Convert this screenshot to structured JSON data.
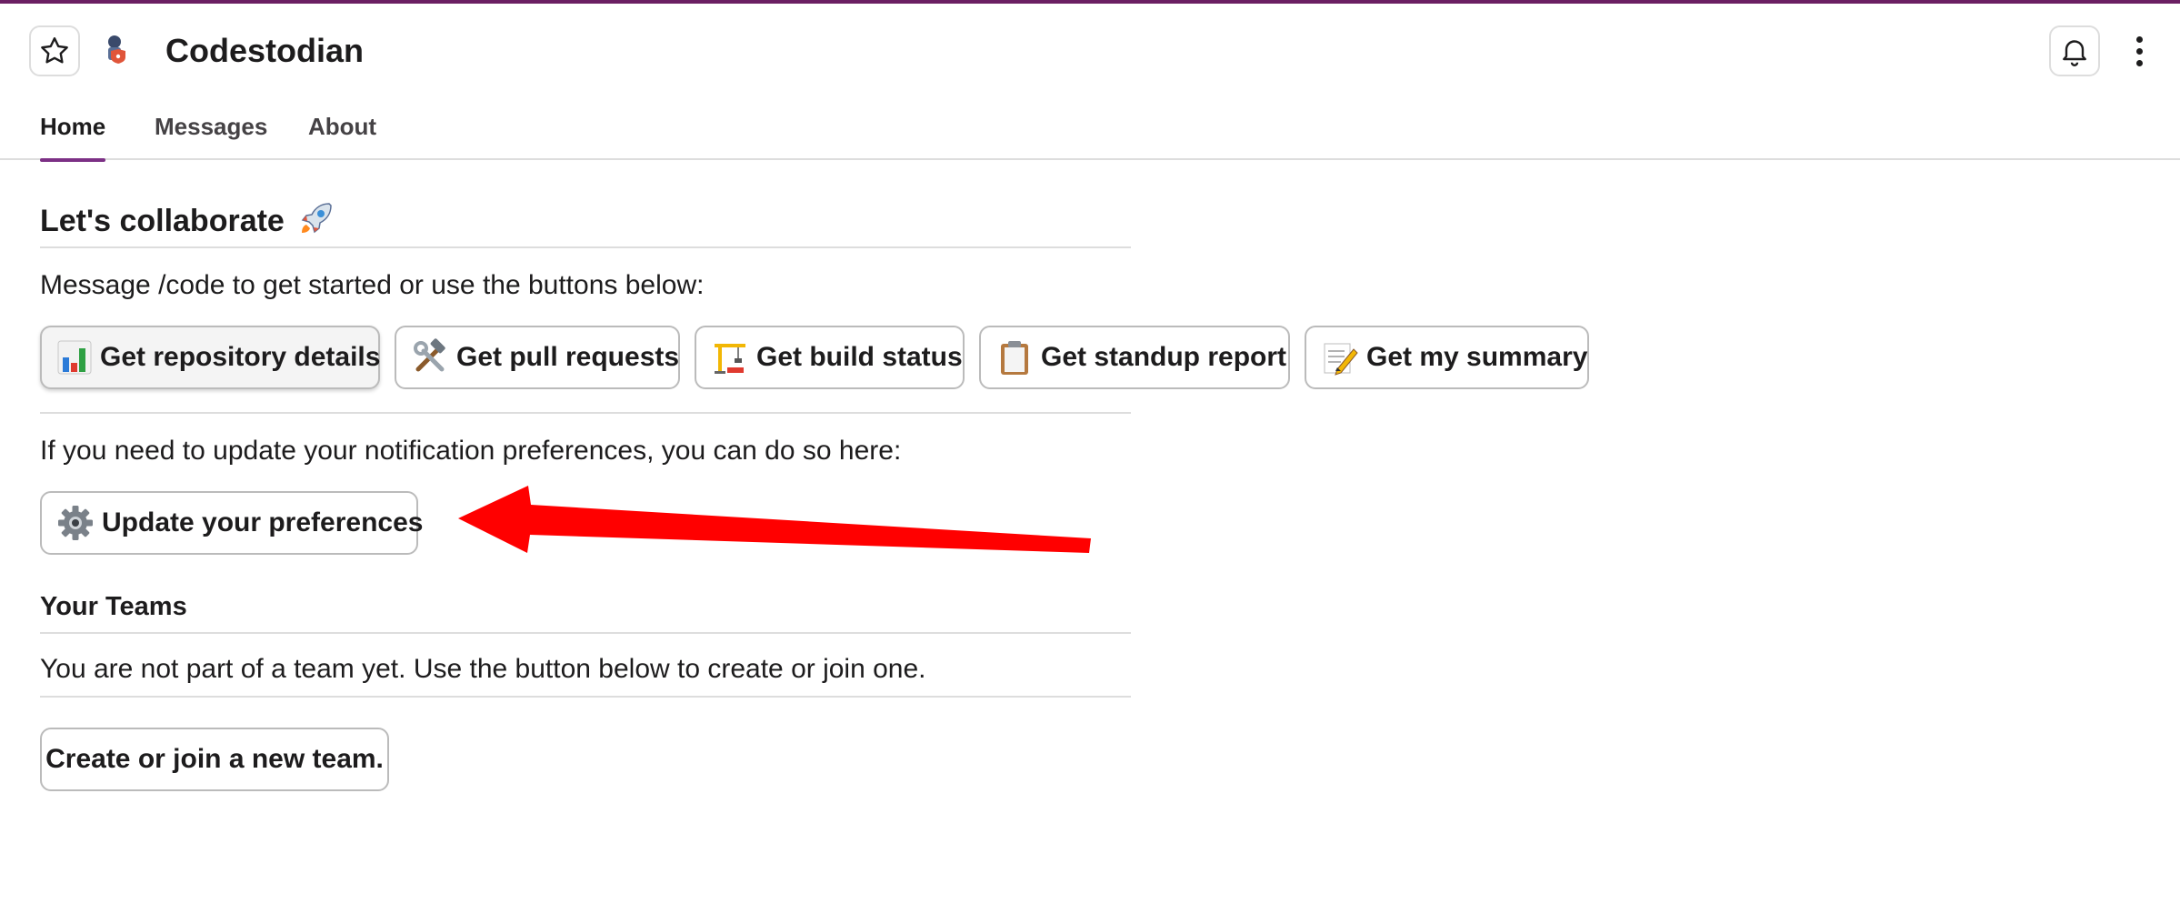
{
  "app": {
    "title": "Codestodian"
  },
  "tabs": [
    {
      "label": "Home",
      "active": true
    },
    {
      "label": "Messages",
      "active": false
    },
    {
      "label": "About",
      "active": false
    }
  ],
  "home": {
    "heading": "Let's collaborate",
    "heading_emoji": "rocket",
    "intro": "Message /code to get started or use the buttons below:",
    "actions": [
      {
        "label": "Get repository details",
        "icon": "bar-chart-icon"
      },
      {
        "label": "Get pull requests",
        "icon": "hammer-wrench-icon"
      },
      {
        "label": "Get build status",
        "icon": "construction-crane-icon"
      },
      {
        "label": "Get standup report",
        "icon": "clipboard-icon"
      },
      {
        "label": "Get my summary",
        "icon": "memo-icon"
      }
    ],
    "prefs_text": "If you need to update your notification preferences, you can do so here:",
    "prefs_button": "Update your preferences",
    "teams_heading": "Your Teams",
    "teams_text": "You are not part of a team yet. Use the button below to create or join one.",
    "teams_button": "Create or join a new team."
  },
  "colors": {
    "accent": "#6b1f63",
    "tab_underline": "#7c3085",
    "annotation_arrow": "#ff0000"
  }
}
